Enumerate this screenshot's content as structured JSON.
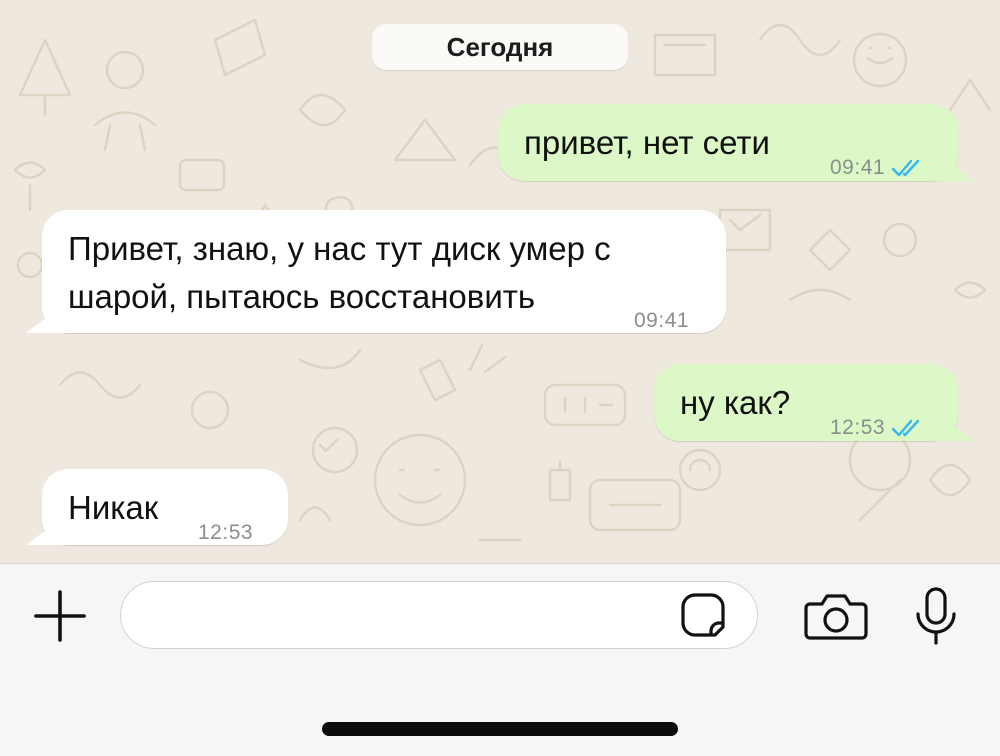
{
  "date_separator": "Сегодня",
  "messages": [
    {
      "direction": "outgoing",
      "lines": [
        "привет, нет сети"
      ],
      "time": "09:41",
      "status": "read",
      "status_icon": "double-check-icon"
    },
    {
      "direction": "incoming",
      "lines": [
        "Привет, знаю, у нас тут диск умер с",
        "шарой, пытаюсь восстановить"
      ],
      "time": "09:41"
    },
    {
      "direction": "outgoing",
      "lines": [
        "ну как?"
      ],
      "time": "12:53",
      "status": "read",
      "status_icon": "double-check-icon"
    },
    {
      "direction": "incoming",
      "lines": [
        "Никак"
      ],
      "time": "12:53"
    }
  ],
  "composer": {
    "attach_icon": "plus-icon",
    "input_value": "",
    "input_placeholder": "",
    "sticker_icon": "sticker-icon",
    "camera_icon": "camera-icon",
    "mic_icon": "microphone-icon"
  },
  "colors": {
    "chat_background": "#efe8de",
    "outgoing_bubble": "#dcf8c6",
    "incoming_bubble": "#ffffff",
    "read_check": "#34b7f1",
    "timestamp": "#8a8f8c"
  }
}
